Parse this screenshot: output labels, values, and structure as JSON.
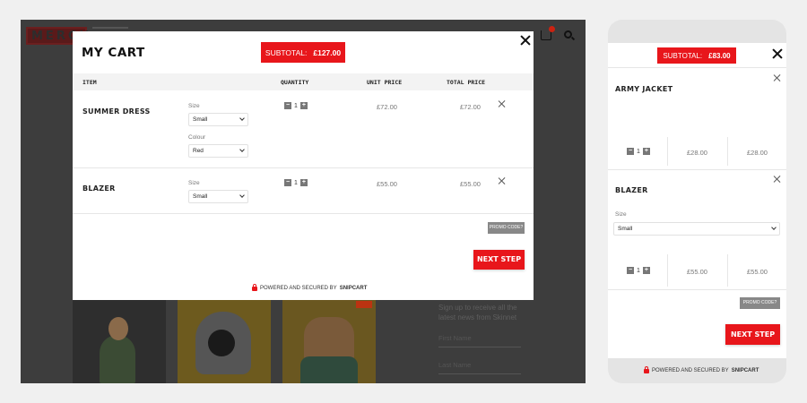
{
  "background_site": {
    "logo": "MERCH",
    "side_text": "Sign up to receive all the latest news from Skinnet",
    "fields": [
      "First Name",
      "Last Name"
    ]
  },
  "cart": {
    "title": "MY CART",
    "subtotal_label": "SUBTOTAL:",
    "subtotal_value": "£127.00",
    "headers": {
      "item": "ITEM",
      "quantity": "QUANTITY",
      "unit_price": "UNIT PRICE",
      "total_price": "TOTAL PRICE"
    },
    "items": [
      {
        "name": "SUMMER DRESS",
        "size_label": "Size",
        "size_value": "Small",
        "colour_label": "Colour",
        "colour_value": "Red",
        "quantity": "1",
        "unit_price": "£72.00",
        "total_price": "£72.00"
      },
      {
        "name": "BLAZER",
        "size_label": "Size",
        "size_value": "Small",
        "quantity": "1",
        "unit_price": "£55.00",
        "total_price": "£55.00"
      }
    ],
    "promo_label": "PROMO CODE?",
    "next_step_label": "NEXT STEP",
    "powered_prefix": "POWERED AND SECURED BY",
    "powered_brand": "SNIPCART"
  },
  "mobile_cart": {
    "subtotal_label": "SUBTOTAL:",
    "subtotal_value": "£83.00",
    "items": [
      {
        "name": "ARMY JACKET",
        "quantity": "1",
        "unit_price": "£28.00",
        "total_price": "£28.00"
      },
      {
        "name": "BLAZER",
        "size_label": "Size",
        "size_value": "Small",
        "quantity": "1",
        "unit_price": "£55.00",
        "total_price": "£55.00"
      }
    ],
    "promo_label": "PROMO CODE?",
    "next_step_label": "NEXT STEP",
    "powered_prefix": "POWERED AND SECURED BY",
    "powered_brand": "SNIPCART"
  },
  "icons": {
    "close": "close-icon",
    "remove": "remove-item-icon",
    "lock": "lock-icon",
    "cart": "cart-icon",
    "search": "search-icon",
    "chevron": "chevron-down-icon"
  },
  "colors": {
    "accent": "#e8161b",
    "overlay": "#3d3d3d",
    "promo_button": "#888888"
  }
}
